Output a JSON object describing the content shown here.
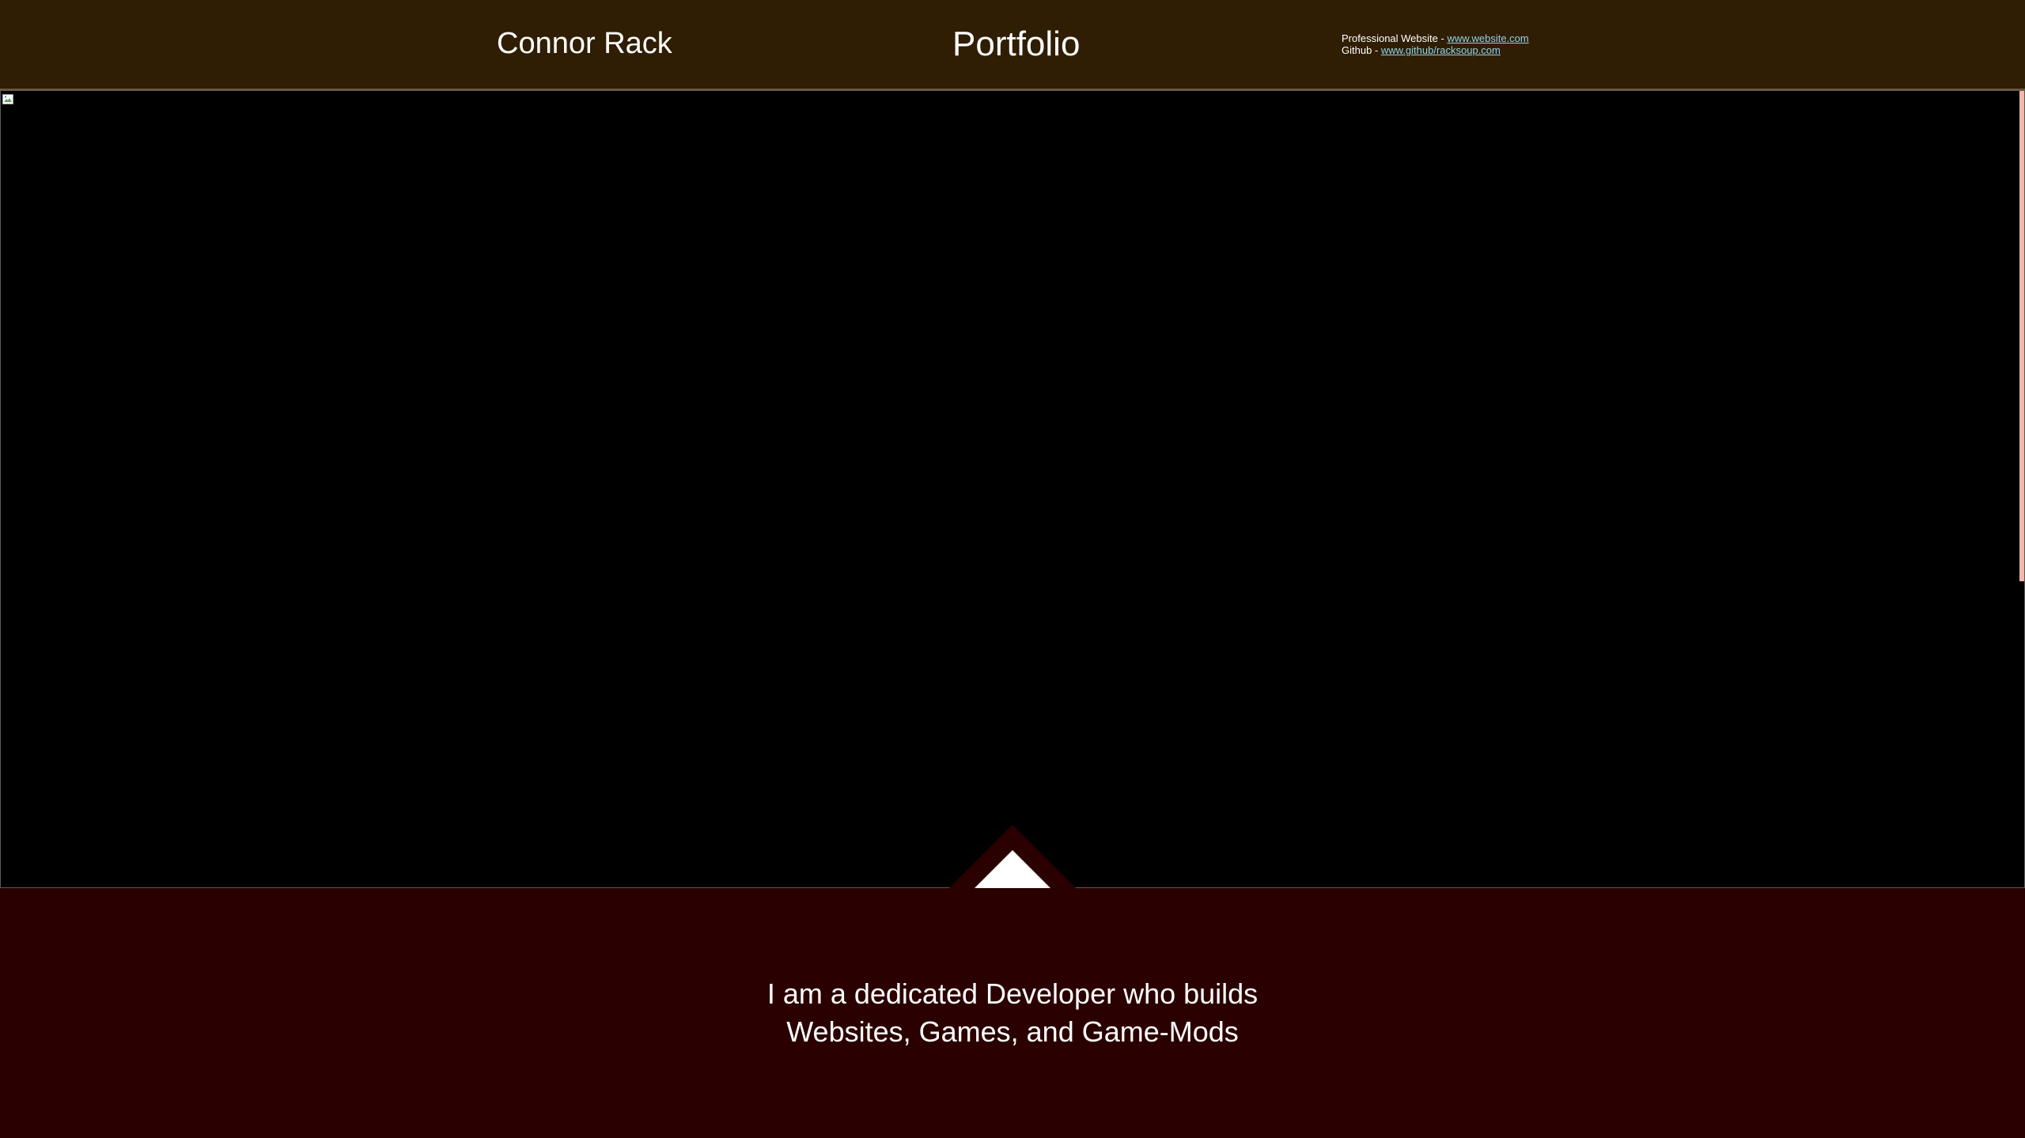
{
  "header": {
    "name": "Connor Rack",
    "title": "Portfolio",
    "contacts": [
      {
        "label": "Professional Website - ",
        "link": "www.website.com"
      },
      {
        "label": "Github - ",
        "link": "www.github/racksoup.com"
      }
    ]
  },
  "hero": {
    "image_icon": "broken-image-icon",
    "arrow_icon": "up-arrow-icon"
  },
  "intro": {
    "line1": "I am a dedicated Developer who builds",
    "line2": "Websites, Games, and Game-Mods"
  },
  "colors": {
    "header_bg": "#301e04",
    "hero_bg": "#000000",
    "body_bg": "#2b0000",
    "link": "#8fd4e8",
    "scrollbar": "#f2b8a8"
  }
}
